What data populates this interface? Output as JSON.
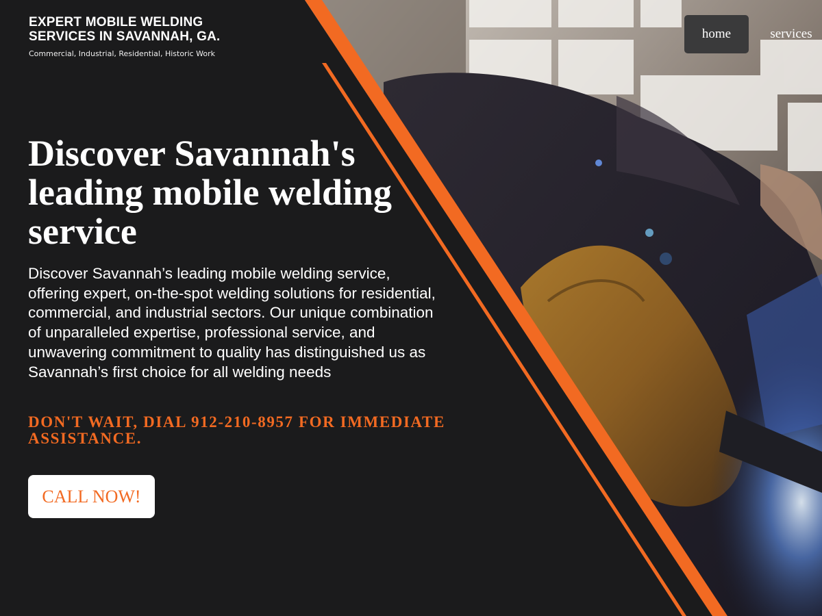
{
  "brand": {
    "title": "EXPERT MOBILE WELDING SERVICES IN SAVANNAH, GA.",
    "tagline": "Commercial, Industrial, Residential, Historic Work"
  },
  "nav": {
    "items": [
      {
        "label": "home",
        "active": true
      },
      {
        "label": "services",
        "active": false
      }
    ]
  },
  "hero": {
    "headline": "Discover Savannah's leading mobile welding service",
    "intro": "Discover Savannah’s leading mobile welding service, offering expert, on-the-spot welding solutions for residential, commercial, and industrial sectors. Our unique combination of unparalleled expertise, professional service, and unwavering commitment to quality has distinguished us as Savannah’s first choice for all welding needs",
    "cta_text": "Don't wait, dial 912-210-8957 for immediate assistance.",
    "cta_button": "CALL NOW!"
  },
  "colors": {
    "accent": "#f26a22",
    "background": "#1b1b1c",
    "nav_active_bg": "#3a3a3b",
    "button_bg": "#ffffff"
  },
  "icons": {
    "hero_image": "welder-photo"
  }
}
